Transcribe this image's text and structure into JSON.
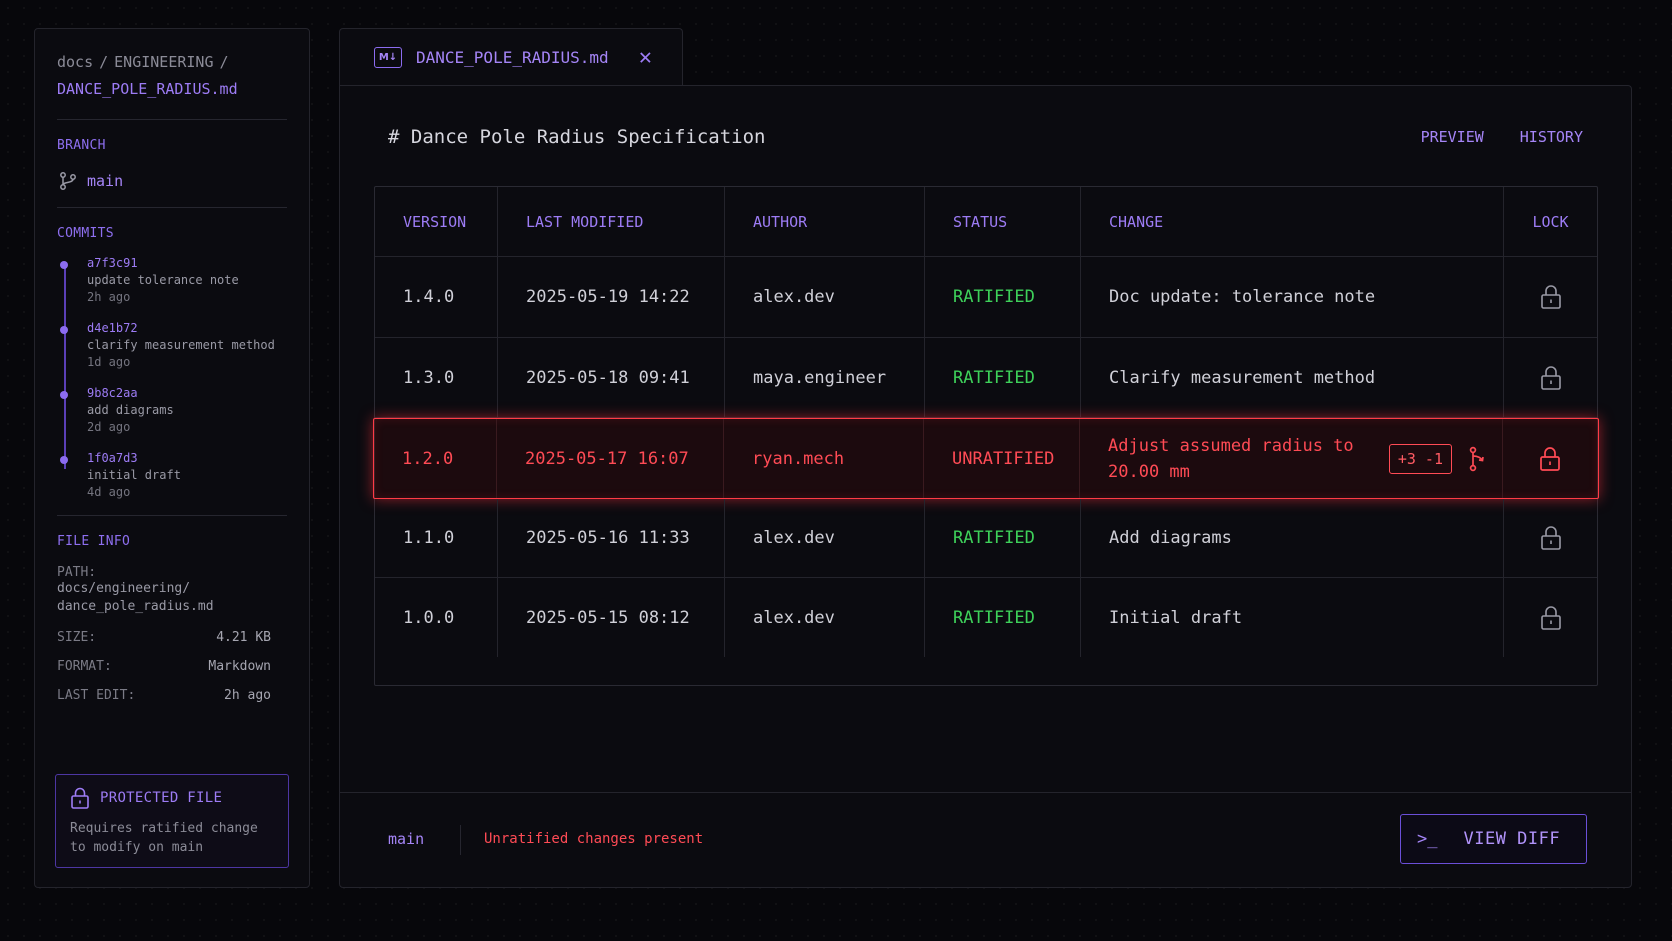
{
  "sidebar": {
    "breadcrumb": {
      "root": "docs",
      "folder": "ENGINEERING",
      "separator": "/",
      "file": "DANCE_POLE_RADIUS.md"
    },
    "branch": {
      "title": "BRANCH",
      "name": "main"
    },
    "commits": {
      "title": "COMMITS",
      "items": [
        {
          "hash": "a7f3c91",
          "message": "update tolerance note",
          "ago": "2h ago"
        },
        {
          "hash": "d4e1b72",
          "message": "clarify measurement method",
          "ago": "1d ago"
        },
        {
          "hash": "9b8c2aa",
          "message": "add diagrams",
          "ago": "2d ago"
        },
        {
          "hash": "1f0a7d3",
          "message": "initial draft",
          "ago": "4d ago"
        }
      ]
    },
    "file_info": {
      "title": "FILE INFO",
      "path_label": "PATH:",
      "path_line1": "docs/engineering/",
      "path_line2": "dance_pole_radius.md",
      "size_label": "SIZE:",
      "size": "4.21 KB",
      "format_label": "FORMAT:",
      "format": "Markdown",
      "last_edit_label": "LAST EDIT:",
      "last_edit": "2h ago"
    },
    "protected": {
      "title": "PROTECTED FILE",
      "desc_line1": "Requires ratified change",
      "desc_line2": "to modify on main"
    }
  },
  "tab": {
    "badge": "M↓",
    "title": "DANCE_POLE_RADIUS.md",
    "close": "✕"
  },
  "doc": {
    "title": "# Dance Pole Radius Specification",
    "preview": "PREVIEW",
    "history": "HISTORY"
  },
  "table": {
    "headers": {
      "version": "VERSION",
      "modified": "LAST MODIFIED",
      "author": "AUTHOR",
      "status": "STATUS",
      "change": "CHANGE",
      "lock": "LOCK"
    },
    "rows": [
      {
        "version": "1.4.0",
        "modified": "2025-05-19 14:22",
        "author": "alex.dev",
        "status": "RATIFIED",
        "change": "Doc update: tolerance note"
      },
      {
        "version": "1.3.0",
        "modified": "2025-05-18 09:41",
        "author": "maya.engineer",
        "status": "RATIFIED",
        "change": "Clarify measurement method"
      },
      {
        "version": "1.2.0",
        "modified": "2025-05-17 16:07",
        "author": "ryan.mech",
        "status": "UNRATIFIED",
        "change_line1": "Adjust assumed radius to",
        "change_line2": "20.00 mm",
        "diff": "+3 -1"
      },
      {
        "version": "1.1.0",
        "modified": "2025-05-16 11:33",
        "author": "alex.dev",
        "status": "RATIFIED",
        "change": "Add diagrams"
      },
      {
        "version": "1.0.0",
        "modified": "2025-05-15 08:12",
        "author": "alex.dev",
        "status": "RATIFIED",
        "change": "Initial draft"
      }
    ]
  },
  "footer": {
    "branch": "main",
    "status": "Unratified changes present",
    "button_prompt": ">_",
    "button_label": "VIEW DIFF"
  },
  "colors": {
    "accent": "#9d7cf5",
    "ok": "#3ed05a",
    "warn": "#ff4b55",
    "bg": "#07070b",
    "panel": "#0b0b10"
  }
}
